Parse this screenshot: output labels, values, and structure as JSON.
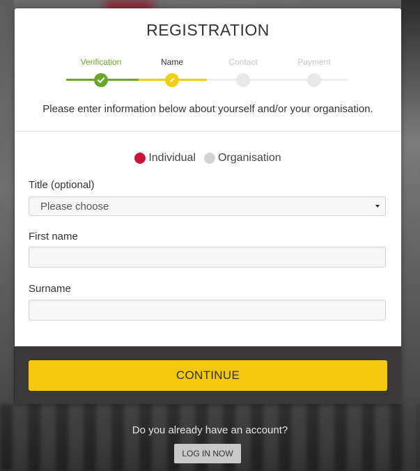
{
  "title": "REGISTRATION",
  "steps": [
    {
      "label": "Verification",
      "state": "done"
    },
    {
      "label": "Name",
      "state": "active"
    },
    {
      "label": "Contact",
      "state": "pending"
    },
    {
      "label": "Payment",
      "state": "pending"
    }
  ],
  "intro": "Please enter information below about yourself and/or your organisation.",
  "account_type": {
    "options": [
      "Individual",
      "Organisation"
    ],
    "selected": "Individual"
  },
  "fields": {
    "title": {
      "label": "Title (optional)",
      "value": "Please choose"
    },
    "first_name": {
      "label": "First name",
      "value": ""
    },
    "surname": {
      "label": "Surname",
      "value": ""
    }
  },
  "continue_label": "CONTINUE",
  "account_question": "Do you already have an account?",
  "login_label": "LOG IN NOW",
  "colors": {
    "done": "#6aa629",
    "active": "#f2cf12",
    "pending": "#dddddd",
    "radio_selected": "#c8133d",
    "radio_unselected": "#d3d3d3",
    "continue": "#f5c70e",
    "footer": "#3a3839"
  },
  "icons": {
    "done": "check-icon",
    "active": "pencil-icon",
    "caret": "chevron-down-icon"
  }
}
